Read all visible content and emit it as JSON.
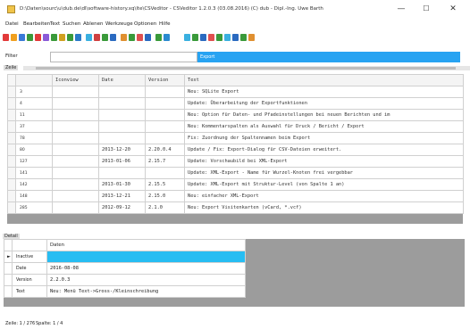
{
  "window": {
    "title": "D:\\Daten\\sourc\\u\\dub.de\\dl\\software-history.xq\\lte\\CSVeditor - CSVeditor 1.2.0.3 (03.08.2016) (C) dub - Dipl.-Ing. Uwe Barth",
    "minimize": "—",
    "maximize": "☐",
    "close": "✕"
  },
  "menu": [
    "Datei",
    "Bearbeiten",
    "Text",
    "Suchen",
    "Ablenen",
    "Werkzeuge",
    "Optionen",
    "Hilfe"
  ],
  "toolbar": {
    "icon_colors": [
      "#e23a3a",
      "#f0a020",
      "#3a7ad8",
      "#3a9a3a",
      "#e23a3a",
      "#8a5ad8",
      "#3a9a3a",
      "#d0a020",
      "#3a9a3a",
      "#2a7ac8",
      "#3ab0e0",
      "#d04040",
      "#3a9a3a",
      "#2a6ac0",
      "#e09030",
      "#3a9a3a",
      "#e05050",
      "#2a6ac0",
      "#3a9a3a",
      "#2a8ad0",
      "#3ab0e0",
      "#3a9a3a",
      "#2a6ac0",
      "#e05050",
      "#3a9a3a",
      "#3ab0e0",
      "#2a6ac0",
      "#3a9a3a",
      "#e09030"
    ]
  },
  "filter": {
    "label": "Filter",
    "input_value": "",
    "select_value": "Export"
  },
  "zeile_label": "Zeile",
  "grid": {
    "columns": [
      "Iconview",
      "Date",
      "Version",
      "Text"
    ],
    "rows": [
      {
        "num": "3",
        "date": "",
        "version": "",
        "text": "Neu: SQLite Export"
      },
      {
        "num": "4",
        "date": "",
        "version": "",
        "text": "Update: Überarbeitung der Exportfunktionen"
      },
      {
        "num": "11",
        "date": "",
        "version": "",
        "text": "Neu: Option für Daten- und Pfadeinstellungen bei neuen Berichten und im"
      },
      {
        "num": "37",
        "date": "",
        "version": "",
        "text": "Neu: Kommentarspalten als Auswahl für Druck / Bericht / Export"
      },
      {
        "num": "78",
        "date": "",
        "version": "",
        "text": "Fix: Zuordnung der Spaltennamen beim Export"
      },
      {
        "num": "80",
        "date": "2013-12-20",
        "version": "2.20.0.4",
        "text": "Update / Fix: Export-Dialog für CSV-Dateien erweitert."
      },
      {
        "num": "127",
        "date": "2013-01-06",
        "version": "2.15.7",
        "text": "Update: Vorschaubild bei XML-Export"
      },
      {
        "num": "141",
        "date": "",
        "version": "",
        "text": "Update: XML-Export - Name für Wurzel-Knoten frei vergebbar"
      },
      {
        "num": "142",
        "date": "2013-01-30",
        "version": "2.15.5",
        "text": "Update: XML-Export mit Struktur-Level (von Spalte 1 an)"
      },
      {
        "num": "148",
        "date": "2013-12-21",
        "version": "2.15.0",
        "text": "Neu: einfacher XML-Export"
      },
      {
        "num": "285",
        "date": "2012-09-12",
        "version": "2.1.0",
        "text": "Neu: Export Visitenkarten (vCard, *.vcf)"
      }
    ]
  },
  "detail": {
    "label": "Detail",
    "header": "Daten",
    "rows": [
      {
        "label": "Inactive",
        "value": "",
        "marker": "►"
      },
      {
        "label": "Date",
        "value": "2016-08-08",
        "marker": ""
      },
      {
        "label": "Version",
        "value": "2.2.0.3",
        "marker": ""
      },
      {
        "label": "Text",
        "value": "Neu: Menü Text->Gross-/Kleinschreibung",
        "marker": ""
      }
    ]
  },
  "status": {
    "line": "Zeile: 1 / 276",
    "col": "Spalte: 1 / 4"
  }
}
